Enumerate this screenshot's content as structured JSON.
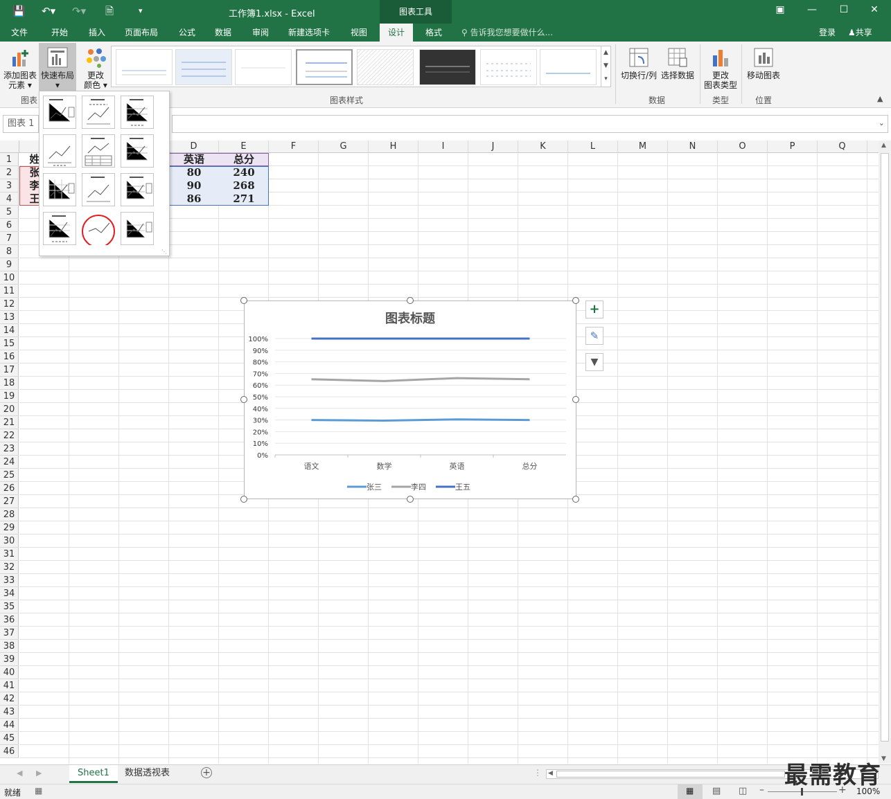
{
  "window": {
    "title": "工作簿1.xlsx - Excel",
    "context_group": "图表工具"
  },
  "tabs": [
    {
      "label": "文件"
    },
    {
      "label": "开始"
    },
    {
      "label": "插入"
    },
    {
      "label": "页面布局"
    },
    {
      "label": "公式"
    },
    {
      "label": "数据"
    },
    {
      "label": "审阅"
    },
    {
      "label": "新建选项卡"
    },
    {
      "label": "视图"
    },
    {
      "label": "设计"
    },
    {
      "label": "格式"
    }
  ],
  "tell_me": "告诉我您想要做什么...",
  "account": {
    "login": "登录",
    "share": "共享"
  },
  "ribbon": {
    "add_element_l1": "添加图表",
    "add_element_l2": "元素",
    "quick_layout": "快速布局",
    "change_colors_l1": "更改",
    "change_colors_l2": "颜色",
    "group_chart_layouts": "图表",
    "group_styles": "图表样式",
    "switch_row_col": "切换行/列",
    "select_data": "选择数据",
    "group_data": "数据",
    "change_type_l1": "更改",
    "change_type_l2": "图表类型",
    "group_type": "类型",
    "move_chart": "移动图表",
    "group_location": "位置"
  },
  "name_box": "图表 1",
  "columns": [
    "D",
    "E",
    "F",
    "G",
    "H",
    "I",
    "J",
    "K",
    "L",
    "M",
    "N",
    "O",
    "P",
    "Q"
  ],
  "rows": [
    "1",
    "2",
    "3",
    "4",
    "5",
    "6",
    "7",
    "8",
    "9",
    "10",
    "11",
    "12",
    "13",
    "14",
    "15",
    "16",
    "17",
    "18",
    "19",
    "20",
    "21",
    "22",
    "23",
    "24",
    "25",
    "26",
    "27",
    "28",
    "29",
    "30",
    "31",
    "32",
    "33",
    "34",
    "35",
    "36",
    "37",
    "38",
    "39",
    "40",
    "41",
    "42",
    "43",
    "44",
    "45",
    "46"
  ],
  "cells": {
    "a1": "姓",
    "a2": "张",
    "a3": "李",
    "a4": "王",
    "d1": "英语",
    "e1": "总分",
    "d2": "80",
    "e2": "240",
    "d3": "90",
    "e3": "268",
    "d4": "86",
    "e4": "271"
  },
  "chart_data": {
    "type": "line",
    "title": "图表标题",
    "categories": [
      "语文",
      "数学",
      "英语",
      "总分"
    ],
    "ylim": [
      0,
      1
    ],
    "yticks": [
      "0%",
      "10%",
      "20%",
      "30%",
      "40%",
      "50%",
      "60%",
      "70%",
      "80%",
      "90%",
      "100%"
    ],
    "series": [
      {
        "name": "张三",
        "color": "#5b9bd5",
        "values": [
          0.3,
          0.295,
          0.305,
          0.3
        ]
      },
      {
        "name": "李四",
        "color": "#a5a5a5",
        "values": [
          0.65,
          0.635,
          0.66,
          0.65
        ]
      },
      {
        "name": "王五",
        "color": "#4472c4",
        "values": [
          1.0,
          1.0,
          1.0,
          1.0
        ]
      }
    ],
    "legend": "bottom",
    "grid": true
  },
  "sheets": [
    {
      "label": "Sheet1",
      "active": true
    },
    {
      "label": "数据透视表",
      "active": false
    }
  ],
  "status": {
    "ready": "就绪",
    "zoom": "100%"
  },
  "watermark": "最需教育"
}
